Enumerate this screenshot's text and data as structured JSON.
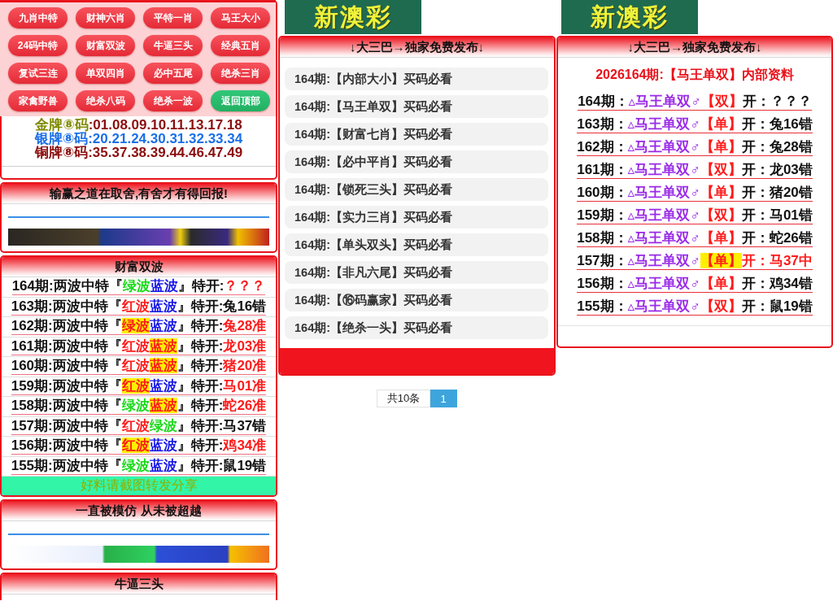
{
  "nav_panel": {
    "buttons": [
      {
        "label": "九肖中特",
        "kind": "link"
      },
      {
        "label": "财神六肖",
        "kind": "link"
      },
      {
        "label": "平特一肖",
        "kind": "link"
      },
      {
        "label": "马王大小",
        "kind": "link"
      },
      {
        "label": "24码中特",
        "kind": "link"
      },
      {
        "label": "财富双波",
        "kind": "link"
      },
      {
        "label": "牛逼三头",
        "kind": "link"
      },
      {
        "label": "经典五肖",
        "kind": "link"
      },
      {
        "label": "复试三连",
        "kind": "link"
      },
      {
        "label": "单双四肖",
        "kind": "link"
      },
      {
        "label": "必中五尾",
        "kind": "link"
      },
      {
        "label": "绝杀三肖",
        "kind": "link"
      },
      {
        "label": "家禽野兽",
        "kind": "link"
      },
      {
        "label": "绝杀八码",
        "kind": "link"
      },
      {
        "label": "绝杀一波",
        "kind": "link"
      },
      {
        "label": "返回顶部",
        "kind": "top"
      }
    ]
  },
  "left_column": {
    "medal_card": {
      "lines": [
        {
          "parts": [
            {
              "text": "金牌⑧码",
              "color": "#7f8a00"
            },
            {
              "text": ":01.08.09.10.11.13.17.18",
              "color": "#8b0c0c"
            }
          ]
        },
        {
          "parts": [
            {
              "text": "银牌⑧码",
              "color": "#1a6fe8"
            },
            {
              "text": ":20.21.24.30.31.32.33.34",
              "color": "#1a6fe8"
            }
          ]
        },
        {
          "parts": [
            {
              "text": "铜牌⑧码",
              "color": "#8b0c0c"
            },
            {
              "text": ":35.37.38.39.44.46.47.49",
              "color": "#8b0c0c"
            }
          ]
        }
      ]
    },
    "ad_card_top": {
      "title": "输赢之道在取舍,有舍才有得回报!"
    },
    "waves_card": {
      "title": "财富双波",
      "rows": [
        {
          "prefix": "164期:两波中特『",
          "waves": [
            {
              "text": "绿波",
              "color": "#16d916",
              "hit": false
            },
            {
              "text": "蓝波",
              "color": "#1414e6",
              "hit": false
            }
          ],
          "suffix": "』特开:",
          "result": {
            "text": "？？？",
            "color": "#ff1a1a"
          }
        },
        {
          "prefix": "163期:两波中特『",
          "waves": [
            {
              "text": "红波",
              "color": "#ff1a1a",
              "hit": false
            },
            {
              "text": "蓝波",
              "color": "#1414e6",
              "hit": false
            }
          ],
          "suffix": "』特开:",
          "result": {
            "text": "兔16错",
            "color": "#111111"
          }
        },
        {
          "prefix": "162期:两波中特『",
          "waves": [
            {
              "text": "绿波",
              "color": "#ff1a1a",
              "hit": true
            },
            {
              "text": "蓝波",
              "color": "#1414e6",
              "hit": false
            }
          ],
          "suffix": "』特开:",
          "result": {
            "text": "兔28准",
            "color": "#ff1a1a"
          }
        },
        {
          "prefix": "161期:两波中特『",
          "waves": [
            {
              "text": "红波",
              "color": "#ff1a1a",
              "hit": false
            },
            {
              "text": "蓝波",
              "color": "#ff1a1a",
              "hit": true
            }
          ],
          "suffix": "』特开:",
          "result": {
            "text": "龙03准",
            "color": "#ff1a1a"
          }
        },
        {
          "prefix": "160期:两波中特『",
          "waves": [
            {
              "text": "红波",
              "color": "#ff1a1a",
              "hit": false
            },
            {
              "text": "蓝波",
              "color": "#ff1a1a",
              "hit": true
            }
          ],
          "suffix": "』特开:",
          "result": {
            "text": "猪20准",
            "color": "#ff1a1a"
          }
        },
        {
          "prefix": "159期:两波中特『",
          "waves": [
            {
              "text": "红波",
              "color": "#ff1a1a",
              "hit": true
            },
            {
              "text": "蓝波",
              "color": "#1414e6",
              "hit": false
            }
          ],
          "suffix": "』特开:",
          "result": {
            "text": "马01准",
            "color": "#ff1a1a"
          }
        },
        {
          "prefix": "158期:两波中特『",
          "waves": [
            {
              "text": "绿波",
              "color": "#16d916",
              "hit": false
            },
            {
              "text": "蓝波",
              "color": "#ff1a1a",
              "hit": true
            }
          ],
          "suffix": "』特开:",
          "result": {
            "text": "蛇26准",
            "color": "#ff1a1a"
          }
        },
        {
          "prefix": "157期:两波中特『",
          "waves": [
            {
              "text": "红波",
              "color": "#ff1a1a",
              "hit": false
            },
            {
              "text": "绿波",
              "color": "#16d916",
              "hit": false
            }
          ],
          "suffix": "』特开:",
          "result": {
            "text": "马37错",
            "color": "#111111"
          }
        },
        {
          "prefix": "156期:两波中特『",
          "waves": [
            {
              "text": "红波",
              "color": "#ff1a1a",
              "hit": true
            },
            {
              "text": "蓝波",
              "color": "#1414e6",
              "hit": false
            }
          ],
          "suffix": "』特开:",
          "result": {
            "text": "鸡34准",
            "color": "#ff1a1a"
          }
        },
        {
          "prefix": "155期:两波中特『",
          "waves": [
            {
              "text": "绿波",
              "color": "#16d916",
              "hit": false
            },
            {
              "text": "蓝波",
              "color": "#1414e6",
              "hit": false
            }
          ],
          "suffix": "』特开:",
          "result": {
            "text": "鼠19错",
            "color": "#111111"
          }
        }
      ],
      "footer": "好料请截图转发分享"
    },
    "ad_card_bottom": {
      "title": "一直被模仿 从未被超越"
    },
    "heads_card": {
      "title": "牛逼三头"
    }
  },
  "middle_column": {
    "logo": "新澳彩",
    "card": {
      "title": "↓大三巴→独家免费发布↓",
      "links": [
        "164期:【内部大小】买码必看",
        "164期:【马王单双】买码必看",
        "164期:【财富七肖】买码必看",
        "164期:【必中平肖】买码必看",
        "164期:【锁死三头】买码必看",
        "164期:【实力三肖】买码必看",
        "164期:【单头双头】买码必看",
        "164期:【非凡六尾】买码必看",
        "164期:【⑯码赢家】买码必看",
        "164期:【绝杀一头】买码必看"
      ]
    },
    "pagination": {
      "total": "共10条",
      "pages": [
        {
          "label": "1",
          "selected": true
        }
      ]
    }
  },
  "right_column": {
    "logo": "新澳彩",
    "card": {
      "title": "↓大三巴→独家免费发布↓",
      "heading": "2026164期:【马王单双】内部资料",
      "rows": [
        {
          "period": "164期：",
          "tag": "▵马王单双♂",
          "pick": "【双】",
          "open": "开：",
          "result": "？？？",
          "hit": false
        },
        {
          "period": "163期：",
          "tag": "▵马王单双♂",
          "pick": "【单】",
          "open": "开：",
          "result": "兔16错",
          "hit": false
        },
        {
          "period": "162期：",
          "tag": "▵马王单双♂",
          "pick": "【单】",
          "open": "开：",
          "result": "兔28错",
          "hit": false
        },
        {
          "period": "161期：",
          "tag": "▵马王单双♂",
          "pick": "【双】",
          "open": "开：",
          "result": "龙03错",
          "hit": false
        },
        {
          "period": "160期：",
          "tag": "▵马王单双♂",
          "pick": "【单】",
          "open": "开：",
          "result": "猪20错",
          "hit": false
        },
        {
          "period": "159期：",
          "tag": "▵马王单双♂",
          "pick": "【双】",
          "open": "开：",
          "result": "马01错",
          "hit": false
        },
        {
          "period": "158期：",
          "tag": "▵马王单双♂",
          "pick": "【单】",
          "open": "开：",
          "result": "蛇26错",
          "hit": false
        },
        {
          "period": "157期：",
          "tag": "▵马王单双♂",
          "pick": "【单】",
          "open": "开：",
          "result": "马37中",
          "hit": true
        },
        {
          "period": "156期：",
          "tag": "▵马王单双♂",
          "pick": "【单】",
          "open": "开：",
          "result": "鸡34错",
          "hit": false
        },
        {
          "period": "155期：",
          "tag": "▵马王单双♂",
          "pick": "【双】",
          "open": "开：",
          "result": "鼠19错",
          "hit": false
        }
      ]
    }
  }
}
